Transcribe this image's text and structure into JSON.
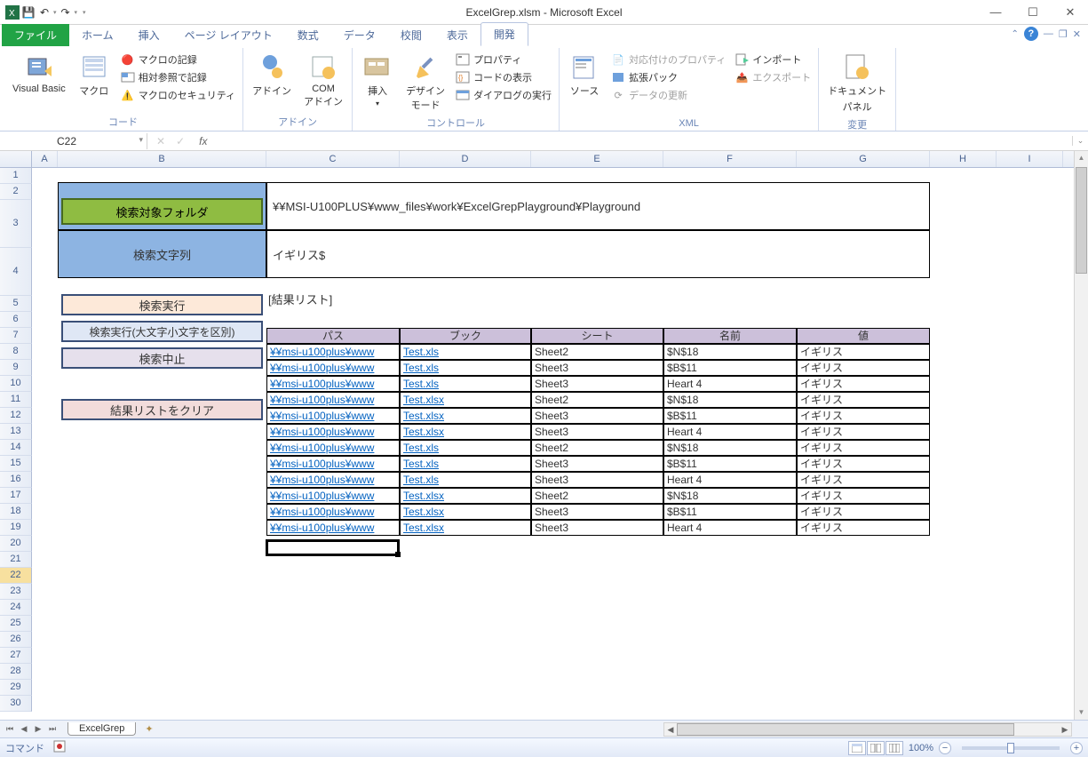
{
  "window": {
    "title": "ExcelGrep.xlsm - Microsoft Excel"
  },
  "qat": {
    "save": "💾",
    "undo": "↶",
    "redo": "↷"
  },
  "menu": {
    "file": "ファイル",
    "tabs": [
      "ホーム",
      "挿入",
      "ページ レイアウト",
      "数式",
      "データ",
      "校閲",
      "表示",
      "開発"
    ],
    "active": 7
  },
  "ribbon": {
    "group_code": {
      "label": "コード",
      "vb": "Visual Basic",
      "macro": "マクロ",
      "record_macro": "マクロの記録",
      "rel_ref": "相対参照で記録",
      "macro_security": "マクロのセキュリティ"
    },
    "group_addin": {
      "label": "アドイン",
      "addin": "アドイン",
      "com_addin": "COM\nアドイン"
    },
    "group_control": {
      "label": "コントロール",
      "insert": "挿入",
      "design_mode": "デザイン\nモード",
      "properties": "プロパティ",
      "view_code": "コードの表示",
      "run_dialog": "ダイアログの実行"
    },
    "group_xml": {
      "label": "XML",
      "source": "ソース",
      "taiou": "対応付けのプロパティ",
      "kakuchou": "拡張パック",
      "refresh": "データの更新",
      "import": "インポート",
      "export": "エクスポート"
    },
    "group_docpanel": {
      "label1": "ドキュメント",
      "label2": "パネル",
      "group_label": "変更"
    }
  },
  "formula": {
    "namebox": "C22",
    "value": ""
  },
  "columns": [
    "A",
    "B",
    "C",
    "D",
    "E",
    "F",
    "G",
    "H",
    "I"
  ],
  "row_count": 30,
  "sheet": {
    "btn_folder": "検索対象フォルダ",
    "folder_path": "¥¥MSI-U100PLUS¥www_files¥work¥ExcelGrepPlayground¥Playground",
    "search_label": "検索文字列",
    "search_value": "イギリス$",
    "btn_exec": "検索実行",
    "btn_exec_case": "検索実行(大文字小文字を区別)",
    "btn_stop": "検索中止",
    "btn_clear": "結果リストをクリア",
    "result_label": "[結果リスト]",
    "headers": [
      "パス",
      "ブック",
      "シート",
      "名前",
      "値"
    ],
    "rows": [
      {
        "path": "¥¥msi-u100plus¥www",
        "book": "Test.xls",
        "sheet": "Sheet2",
        "name": "$N$18",
        "value": "イギリス"
      },
      {
        "path": "¥¥msi-u100plus¥www",
        "book": "Test.xls",
        "sheet": "Sheet3",
        "name": "$B$11",
        "value": "イギリス"
      },
      {
        "path": "¥¥msi-u100plus¥www",
        "book": "Test.xls",
        "sheet": "Sheet3",
        "name": "Heart 4",
        "value": "イギリス"
      },
      {
        "path": "¥¥msi-u100plus¥www",
        "book": "Test.xlsx",
        "sheet": "Sheet2",
        "name": "$N$18",
        "value": "イギリス"
      },
      {
        "path": "¥¥msi-u100plus¥www",
        "book": "Test.xlsx",
        "sheet": "Sheet3",
        "name": "$B$11",
        "value": "イギリス"
      },
      {
        "path": "¥¥msi-u100plus¥www",
        "book": "Test.xlsx",
        "sheet": "Sheet3",
        "name": "Heart 4",
        "value": "イギリス"
      },
      {
        "path": "¥¥msi-u100plus¥www",
        "book": "Test.xls",
        "sheet": "Sheet2",
        "name": "$N$18",
        "value": "イギリス"
      },
      {
        "path": "¥¥msi-u100plus¥www",
        "book": "Test.xls",
        "sheet": "Sheet3",
        "name": "$B$11",
        "value": "イギリス"
      },
      {
        "path": "¥¥msi-u100plus¥www",
        "book": "Test.xls",
        "sheet": "Sheet3",
        "name": "Heart 4",
        "value": "イギリス"
      },
      {
        "path": "¥¥msi-u100plus¥www",
        "book": "Test.xlsx",
        "sheet": "Sheet2",
        "name": "$N$18",
        "value": "イギリス"
      },
      {
        "path": "¥¥msi-u100plus¥www",
        "book": "Test.xlsx",
        "sheet": "Sheet3",
        "name": "$B$11",
        "value": "イギリス"
      },
      {
        "path": "¥¥msi-u100plus¥www",
        "book": "Test.xlsx",
        "sheet": "Sheet3",
        "name": "Heart 4",
        "value": "イギリス"
      }
    ]
  },
  "sheet_tab": "ExcelGrep",
  "status": {
    "left": "コマンド",
    "zoom": "100%"
  }
}
